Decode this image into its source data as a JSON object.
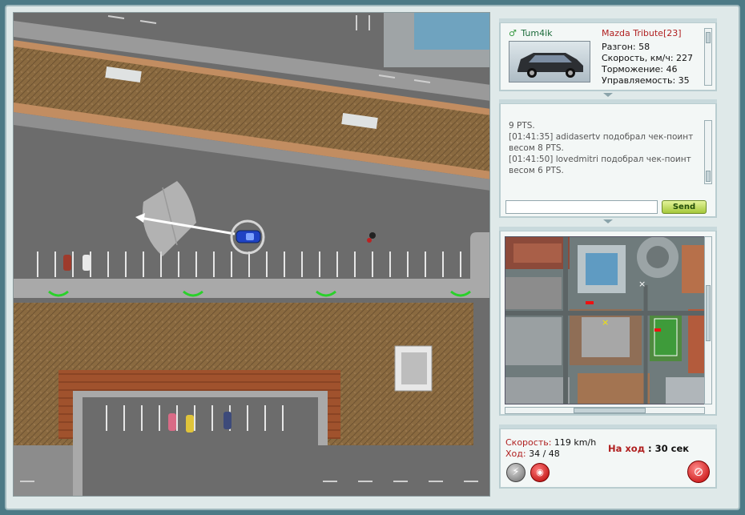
{
  "player": {
    "name": "Tum4ik",
    "car_model": "Mazda Tribute[23]",
    "stats": [
      "Разгон: 58",
      "Скорость, км/ч: 227",
      "Торможение: 46",
      "Управляемость: 35"
    ]
  },
  "chat": {
    "messages": [
      "9 PTS.",
      "[01:41:35] adidasertv подобрал чек-поинт весом 8 PTS.",
      "[01:41:50] lovedmitri подобрал чек-поинт весом 6 PTS."
    ],
    "input_value": "",
    "send_label": "Send"
  },
  "status": {
    "speed_label": "Скорость:",
    "speed_value": "119 km/h",
    "move_label": "Ход:",
    "move_value": "34 / 48",
    "turn_label": "На ход",
    "turn_value": ": 30 сек"
  },
  "icons": {
    "user": "user-icon",
    "power": "lightning-icon",
    "signal": "signal-icon",
    "stop": "stop-icon"
  },
  "colors": {
    "accent_red": "#b02020",
    "send_green": "#a6c93b",
    "player_car": "#1f43c4"
  }
}
